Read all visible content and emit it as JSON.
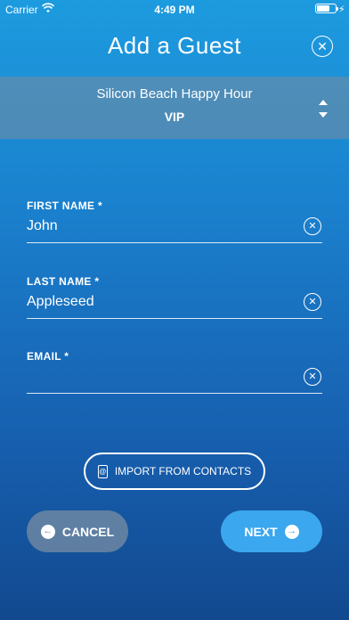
{
  "status_bar": {
    "carrier": "Carrier",
    "time": "4:49 PM",
    "icons": [
      "wifi-icon",
      "battery-icon",
      "bolt-icon"
    ]
  },
  "header": {
    "title": "Add a Guest",
    "close_icon": "close-icon"
  },
  "event": {
    "name": "Silicon Beach Happy Hour",
    "tier": "VIP",
    "selector_icon": "sort-icon"
  },
  "form": {
    "first_name": {
      "label": "FIRST NAME *",
      "value": "John"
    },
    "last_name": {
      "label": "LAST NAME *",
      "value": "Appleseed"
    },
    "email": {
      "label": "EMAIL *",
      "value": ""
    }
  },
  "import": {
    "label": "IMPORT FROM CONTACTS",
    "icon_glyph": "@"
  },
  "actions": {
    "cancel_label": "CANCEL",
    "next_label": "NEXT"
  },
  "colors": {
    "gradient_top": "#1d9bdf",
    "gradient_bottom": "#12498f",
    "next_button": "#3aa7ee",
    "cancel_button": "#8796a5"
  }
}
